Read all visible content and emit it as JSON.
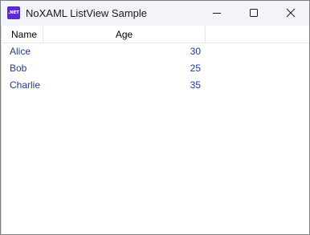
{
  "window": {
    "title": "NoXAML ListView Sample",
    "icon_text": ".NET",
    "icon_color": "#5b2bd6"
  },
  "caption_buttons": {
    "minimize_icon": "minimize-icon",
    "maximize_icon": "maximize-icon",
    "close_icon": "close-icon"
  },
  "listview": {
    "columns": [
      "Name",
      "Age"
    ],
    "rows": [
      {
        "name": "Alice",
        "age": "30"
      },
      {
        "name": "Bob",
        "age": "25"
      },
      {
        "name": "Charlie",
        "age": "35"
      }
    ],
    "text_color": "#1f3a93"
  }
}
